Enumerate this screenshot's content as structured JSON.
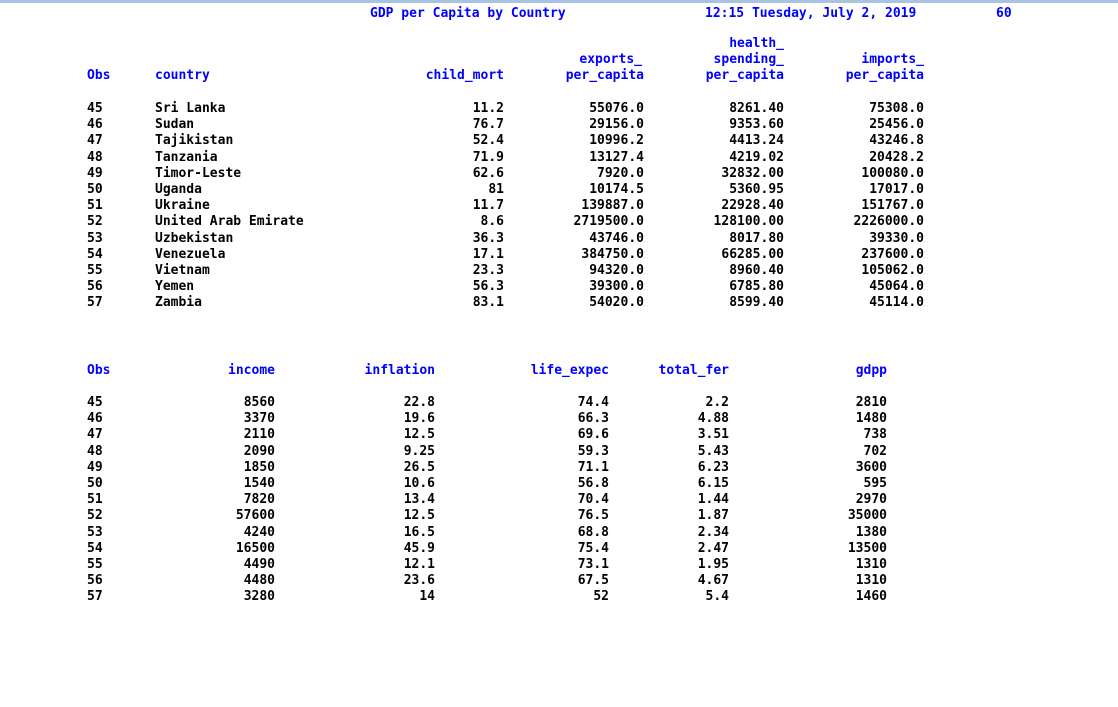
{
  "header": {
    "title": "GDP per Capita by Country",
    "datetime": "12:15 Tuesday, July 2, 2019",
    "page": "60"
  },
  "table1": {
    "headers": {
      "obs": "Obs",
      "country": "country",
      "child_mort": "child_mort",
      "exports_1": "exports_",
      "exports_2": "per_capita",
      "health_1": "health_",
      "health_2": "spending_",
      "health_3": "per_capita",
      "imports_1": "imports_",
      "imports_2": "per_capita"
    },
    "rows": [
      {
        "obs": "45",
        "country": "Sri Lanka",
        "child_mort": "11.2",
        "exports": "55076.0",
        "health": "8261.40",
        "imports": "75308.0"
      },
      {
        "obs": "46",
        "country": "Sudan",
        "child_mort": "76.7",
        "exports": "29156.0",
        "health": "9353.60",
        "imports": "25456.0"
      },
      {
        "obs": "47",
        "country": "Tajikistan",
        "child_mort": "52.4",
        "exports": "10996.2",
        "health": "4413.24",
        "imports": "43246.8"
      },
      {
        "obs": "48",
        "country": "Tanzania",
        "child_mort": "71.9",
        "exports": "13127.4",
        "health": "4219.02",
        "imports": "20428.2"
      },
      {
        "obs": "49",
        "country": "Timor-Leste",
        "child_mort": "62.6",
        "exports": "7920.0",
        "health": "32832.00",
        "imports": "100080.0"
      },
      {
        "obs": "50",
        "country": "Uganda",
        "child_mort": "81",
        "exports": "10174.5",
        "health": "5360.95",
        "imports": "17017.0"
      },
      {
        "obs": "51",
        "country": "Ukraine",
        "child_mort": "11.7",
        "exports": "139887.0",
        "health": "22928.40",
        "imports": "151767.0"
      },
      {
        "obs": "52",
        "country": "United Arab Emirate",
        "child_mort": "8.6",
        "exports": "2719500.0",
        "health": "128100.00",
        "imports": "2226000.0"
      },
      {
        "obs": "53",
        "country": "Uzbekistan",
        "child_mort": "36.3",
        "exports": "43746.0",
        "health": "8017.80",
        "imports": "39330.0"
      },
      {
        "obs": "54",
        "country": "Venezuela",
        "child_mort": "17.1",
        "exports": "384750.0",
        "health": "66285.00",
        "imports": "237600.0"
      },
      {
        "obs": "55",
        "country": "Vietnam",
        "child_mort": "23.3",
        "exports": "94320.0",
        "health": "8960.40",
        "imports": "105062.0"
      },
      {
        "obs": "56",
        "country": "Yemen",
        "child_mort": "56.3",
        "exports": "39300.0",
        "health": "6785.80",
        "imports": "45064.0"
      },
      {
        "obs": "57",
        "country": "Zambia",
        "child_mort": "83.1",
        "exports": "54020.0",
        "health": "8599.40",
        "imports": "45114.0"
      }
    ]
  },
  "table2": {
    "headers": {
      "obs": "Obs",
      "income": "income",
      "inflation": "inflation",
      "life_expec": "life_expec",
      "total_fer": "total_fer",
      "gdpp": "gdpp"
    },
    "rows": [
      {
        "obs": "45",
        "income": "8560",
        "inflation": "22.8",
        "life_expec": "74.4",
        "total_fer": "2.2",
        "gdpp": "2810"
      },
      {
        "obs": "46",
        "income": "3370",
        "inflation": "19.6",
        "life_expec": "66.3",
        "total_fer": "4.88",
        "gdpp": "1480"
      },
      {
        "obs": "47",
        "income": "2110",
        "inflation": "12.5",
        "life_expec": "69.6",
        "total_fer": "3.51",
        "gdpp": "738"
      },
      {
        "obs": "48",
        "income": "2090",
        "inflation": "9.25",
        "life_expec": "59.3",
        "total_fer": "5.43",
        "gdpp": "702"
      },
      {
        "obs": "49",
        "income": "1850",
        "inflation": "26.5",
        "life_expec": "71.1",
        "total_fer": "6.23",
        "gdpp": "3600"
      },
      {
        "obs": "50",
        "income": "1540",
        "inflation": "10.6",
        "life_expec": "56.8",
        "total_fer": "6.15",
        "gdpp": "595"
      },
      {
        "obs": "51",
        "income": "7820",
        "inflation": "13.4",
        "life_expec": "70.4",
        "total_fer": "1.44",
        "gdpp": "2970"
      },
      {
        "obs": "52",
        "income": "57600",
        "inflation": "12.5",
        "life_expec": "76.5",
        "total_fer": "1.87",
        "gdpp": "35000"
      },
      {
        "obs": "53",
        "income": "4240",
        "inflation": "16.5",
        "life_expec": "68.8",
        "total_fer": "2.34",
        "gdpp": "1380"
      },
      {
        "obs": "54",
        "income": "16500",
        "inflation": "45.9",
        "life_expec": "75.4",
        "total_fer": "2.47",
        "gdpp": "13500"
      },
      {
        "obs": "55",
        "income": "4490",
        "inflation": "12.1",
        "life_expec": "73.1",
        "total_fer": "1.95",
        "gdpp": "1310"
      },
      {
        "obs": "56",
        "income": "4480",
        "inflation": "23.6",
        "life_expec": "67.5",
        "total_fer": "4.67",
        "gdpp": "1310"
      },
      {
        "obs": "57",
        "income": "3280",
        "inflation": "14",
        "life_expec": "52",
        "total_fer": "5.4",
        "gdpp": "1460"
      }
    ]
  }
}
